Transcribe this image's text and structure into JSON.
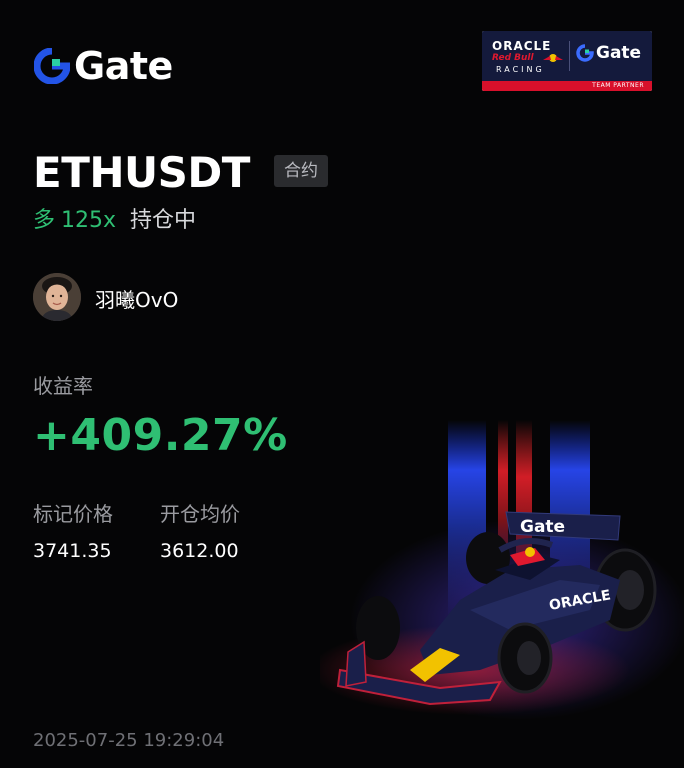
{
  "brand": {
    "name": "Gate",
    "accent": "#2354e6"
  },
  "partner_badge": {
    "oracle": "ORACLE",
    "redbull": "Red Bull",
    "racing": "RACING",
    "gate": "Gate",
    "team_partner": "TEAM PARTNER"
  },
  "trade": {
    "symbol": "ETHUSDT",
    "type_badge": "合约",
    "side": "多",
    "leverage": "125x",
    "status": "持仓中"
  },
  "user": {
    "name": "羽曦OvO"
  },
  "roi": {
    "label": "收益率",
    "value": "+409.27%"
  },
  "prices": {
    "mark_label": "标记价格",
    "mark_value": "3741.35",
    "entry_label": "开仓均价",
    "entry_value": "3612.00"
  },
  "timestamp": "2025-07-25 19:29:04",
  "car_livery": {
    "wing_text": "Gate",
    "sidepod_text": "ORACLE"
  },
  "colors": {
    "positive": "#2fbf73",
    "background": "#050506",
    "muted": "#9a9ba0"
  }
}
